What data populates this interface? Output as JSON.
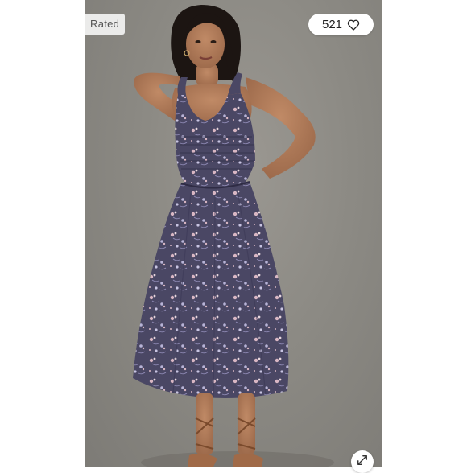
{
  "listing": {
    "badge_label": "Rated",
    "like_count": "521",
    "like_icon": "heart-outline-icon",
    "expand_icon": "expand-arrows-icon"
  },
  "colors": {
    "background": "#8c8a84",
    "dress": "#4a4764",
    "print_pink": "#d9b7c4",
    "print_lavender": "#b7b3d6",
    "skin": "#b07a58",
    "hair": "#1c1512"
  }
}
